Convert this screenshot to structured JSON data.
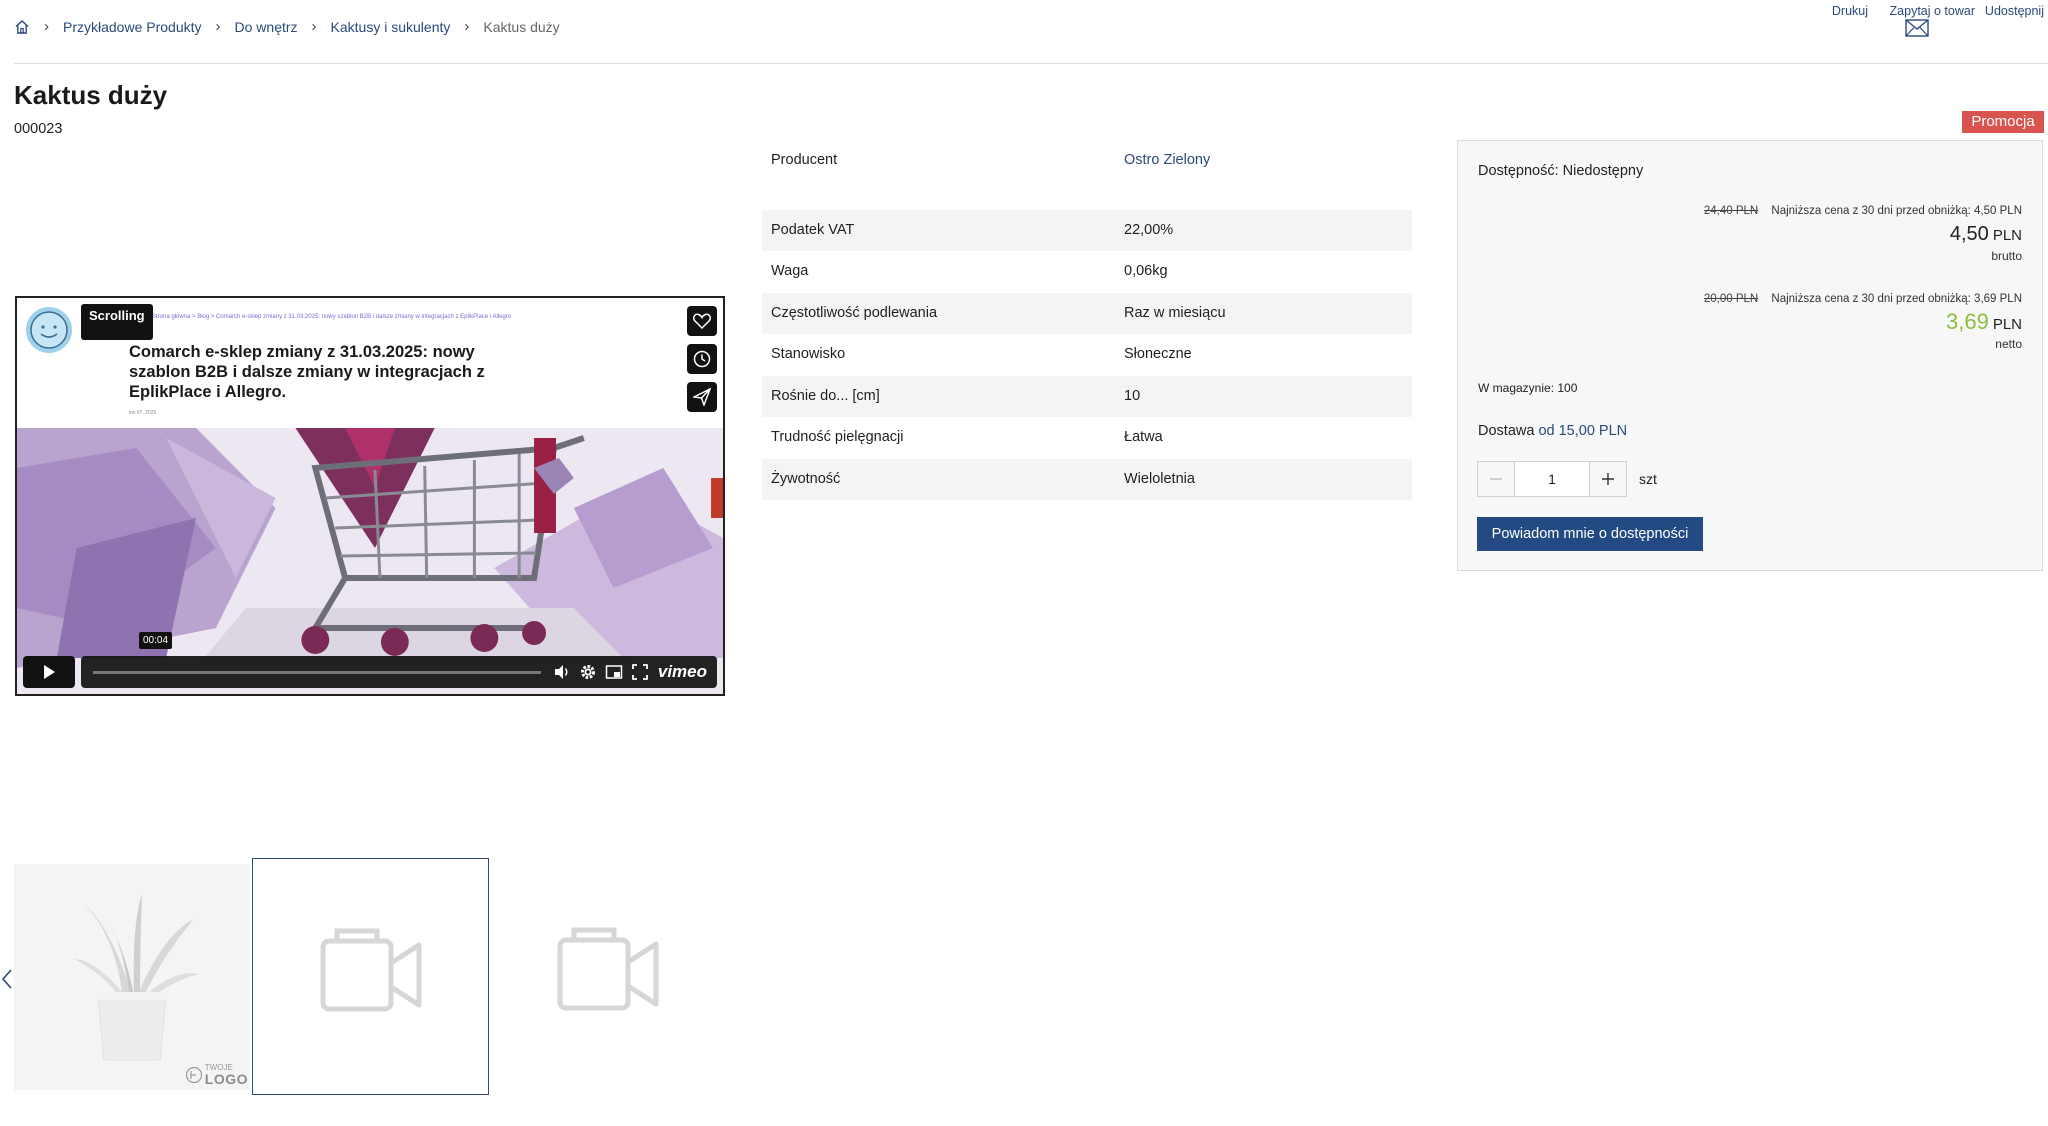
{
  "breadcrumb": {
    "items": [
      "Przykładowe Produkty",
      "Do wnętrz",
      "Kaktusy i sukulenty"
    ],
    "current": "Kaktus duży"
  },
  "top_actions": {
    "print": "Drukuj",
    "ask": "Zapytaj o towar",
    "share": "Udostępnij"
  },
  "product": {
    "title": "Kaktus duży",
    "sku": "000023"
  },
  "video": {
    "badge": "Scrolling",
    "breadcrumb_text": "Strona główna  >  Blog  >  Comarch e-sklep zmiany z 31.03.2025: nowy szablon B2B i dalsze zmiany w integracjach z EplikPlace i Allegro",
    "headline": "Comarch e-sklep zmiany z 31.03.2025: nowy szablon B2B i dalsze zmiany w integracjach z EplikPlace i Allegro.",
    "date": "irw 07, 2025",
    "time": "00:04",
    "logo": "vimeo"
  },
  "attributes": {
    "producer": {
      "label": "Producent",
      "value": "Ostro Zielony"
    },
    "rows": [
      {
        "label": "Podatek VAT",
        "value": "22,00%"
      },
      {
        "label": "Waga",
        "value": "0,06kg"
      },
      {
        "label": "Częstotliwość podlewania",
        "value": "Raz w miesiącu"
      },
      {
        "label": "Stanowisko",
        "value": "Słoneczne"
      },
      {
        "label": "Rośnie do... [cm]",
        "value": "10"
      },
      {
        "label": "Trudność pielęgnacji",
        "value": "Łatwa"
      },
      {
        "label": "Żywotność",
        "value": "Wieloletnia"
      }
    ]
  },
  "pricing": {
    "promo_badge": "Promocja",
    "availability": "Dostępność: Niedostępny",
    "gross": {
      "old": "24,40 PLN",
      "lowest": "Najniższa cena z 30 dni przed obniżką: 4,50 PLN",
      "price": "4,50",
      "currency": "PLN",
      "type": "brutto"
    },
    "net": {
      "old": "20,00 PLN",
      "lowest": "Najniższa cena z 30 dni przed obniżką: 3,69 PLN",
      "price": "3,69",
      "currency": "PLN",
      "type": "netto"
    },
    "net_color": "#8cbf3f",
    "stock": "W magazynie: 100",
    "delivery_label": "Dostawa",
    "delivery_value": "od 15,00 PLN",
    "quantity": "1",
    "unit": "szt",
    "notify_button": "Powiadom mnie o dostępności"
  },
  "thumbnails": {
    "logo_small": "TWOJE",
    "logo_big": "LOGO"
  },
  "colors": {
    "accent": "#234a82",
    "link": "#2b4a7a",
    "promo": "#d9534f"
  }
}
